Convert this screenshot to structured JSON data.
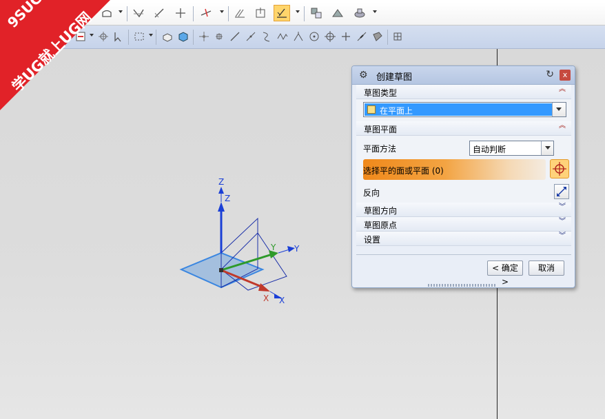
{
  "watermark": {
    "line1": "9SUG",
    "line2": "学UG就上UG网"
  },
  "dialog": {
    "title": "创建草图",
    "icons": {
      "settings": "gear-icon",
      "reset": "reset-icon",
      "close": "close-icon"
    },
    "close_glyph": "x",
    "sections": {
      "sketch_type": {
        "label": "草图类型",
        "value": "在平面上"
      },
      "sketch_plane": {
        "label": "草图平面",
        "method_label": "平面方法",
        "method_value": "自动判断",
        "select_prompt": "选择平的面或平面 (0)",
        "reverse_label": "反向"
      },
      "sketch_orientation": {
        "label": "草图方向"
      },
      "sketch_origin": {
        "label": "草图原点"
      },
      "settings": {
        "label": "设置"
      }
    },
    "ok_label": "< 确定 >",
    "cancel_label": "取消"
  },
  "viewport": {
    "axes": {
      "z_label": "Z",
      "z_label2": "Z",
      "y_label": "Y",
      "y_label2": "Y",
      "x_label": "X",
      "x_label2": "X"
    },
    "colors": {
      "z": "#1a3fd6",
      "y": "#2e9a2a",
      "x": "#c0392b",
      "plane": "#3a86e0"
    }
  }
}
